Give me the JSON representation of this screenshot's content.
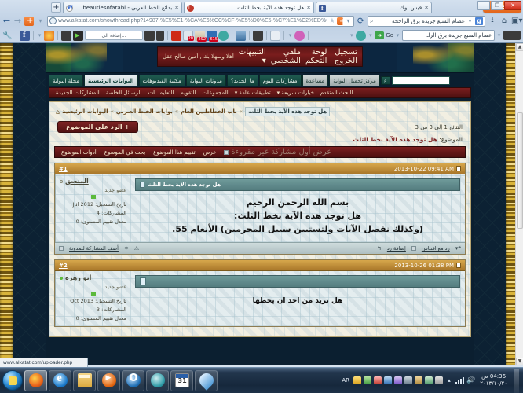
{
  "browser": {
    "app_button": "Firefox",
    "tabs": [
      {
        "label": "فيس بوك",
        "favicon": "facebook-icon",
        "active": false
      },
      {
        "label": "هل توجد هذه الآية بخط الثلث",
        "favicon": "forum-icon",
        "active": true
      },
      {
        "label": "بدائع الخط العربي - beautiesofarabi...",
        "favicon": "wordpress-icon",
        "active": false
      }
    ],
    "new_tab_label": "+",
    "window_controls": {
      "minimize": "–",
      "maximize": "❐",
      "close": "✕"
    },
    "url": "www.alkatat.com/showthread.php?14987-%E5%E1-%CA%E6%CC%CF-%E5%D0%E5-%C7%E1%C2%ED%C9-%C8%CE%D8-%C7%",
    "url_prefix": "www.alkatat.com",
    "url_host_bold": "alkatat.com",
    "search_engine": "Google",
    "search_value": "عصام السبع جريدة برق الراجحة",
    "bookmarks_go_value": "عصام السبع جريدة برق الراـ",
    "go_button": "Go",
    "bookmark_badges": [
      "20",
      "292",
      "615"
    ],
    "status_url": "www.alkatat.com/uploader.php"
  },
  "forum": {
    "welcome": {
      "greeting": "أهلا وسهلا بك , أمين صالح عقل",
      "links": [
        "التنبيهات ▾",
        "ملفي الشخصي",
        "لوحة التحكم",
        "تسجيل الخروج"
      ]
    },
    "nav_primary": [
      {
        "label": "مجلة البوابة",
        "state": "normal"
      },
      {
        "label": "البوابات الرئيسية",
        "state": "selected"
      },
      {
        "label": "مكتبة الفيديوهات",
        "state": "normal"
      },
      {
        "label": "مدونات البوابة",
        "state": "normal"
      },
      {
        "label": "ما الجديد؟",
        "state": "normal"
      },
      {
        "label": "مشاركات اليوم",
        "state": "normal"
      },
      {
        "label": "مساعدة",
        "state": "grey"
      },
      {
        "label": "مركز تحميل البوابة",
        "state": "grey"
      }
    ],
    "search": {
      "value": "",
      "button": "⌕"
    },
    "nav_secondary": [
      "المشاركات الجديدة",
      "الرسائل الخاصة",
      "التعليمـــات",
      "التقويم",
      "المجموعات",
      "تطبيقات عامة ▾",
      "خيارات سريعة ▾"
    ],
    "nav_secondary_advanced": "البحث المتقدم",
    "breadcrumb": {
      "home_icon": "home-icon",
      "items": [
        "البوابات الرئيسية",
        "بوابات الخـط العـربي",
        "باب الخطاطـين العام"
      ],
      "current": "هل توجد هذه الآية بخط الثلث",
      "separator": "»"
    },
    "reply_button": "+ الرد على الموضوع",
    "results_text": "النتائج 1 إلى 3 من 3",
    "subject_label": "الموضوع:",
    "subject_value": "هل توجد هذه الآية بخط الثلث",
    "thread_toolbar": [
      "أدوات الموضوع",
      "بحث في الموضوع",
      "تقييم هذا الموضوع",
      "عرض"
    ],
    "thread_toolbar_greyed": "عرض أول مشاركة غير مقروءة",
    "posts": [
      {
        "number": "#1",
        "date": "2013-10-22 09:41 AM",
        "user": {
          "name": "المنسق",
          "rank": "عضو جديد",
          "join_label": "تاريخ التسجيل:",
          "join_value": "Jul 2012",
          "posts_label": "المشاركات:",
          "posts_value": "4",
          "rep_label": "معدل تقييم المستوى:",
          "rep_value": "0",
          "online": false
        },
        "title": "هل توجد هذه الآية بخط الثلث",
        "lines": [
          "بسم الله الرحمن الرحيم",
          "هل توجد هذه الآية بخط الثلث:",
          "(وكذلك نفصل الآيات ولتستبين سبيل المجرمين) الأنعام 55."
        ],
        "footer": {
          "blog_link": "أضف المشاركة للمدونة",
          "reply_link": "إضافة رد",
          "quote_link": "رد مع اقتباس"
        }
      },
      {
        "number": "#2",
        "date": "2013-10-26 01:38 PM",
        "user": {
          "name": "أبو زهره",
          "rank": "عضو جديد",
          "join_label": "تاريخ التسجيل:",
          "join_value": "Oct 2013",
          "posts_label": "المشاركات:",
          "posts_value": "3",
          "rep_label": "معدل تقييم المستوى:",
          "rep_value": "0",
          "online": true
        },
        "title": "",
        "lines": [
          "هل تريد من احد ان يخطها"
        ],
        "footer": {
          "blog_link": "",
          "reply_link": "",
          "quote_link": ""
        }
      }
    ]
  },
  "taskbar": {
    "start": "start-orb",
    "buttons": [
      "firefox-taskbar-button",
      "internet-explorer-taskbar-button",
      "file-explorer-taskbar-button",
      "media-player-taskbar-button",
      "opera-taskbar-button",
      "messenger-taskbar-button",
      "calendar-taskbar-button",
      "paint-taskbar-button"
    ],
    "language": "AR",
    "clock_time": "04:36 ص",
    "clock_date": "٢٠١٣/١٠/٢٠"
  },
  "colors": {
    "accent_gold": "#c49a2c",
    "accent_maroon": "#7c1f1f",
    "accent_teal": "#1f5a4f",
    "page_bg": "#0c2133",
    "content_bg": "#f2efe2",
    "post_bg": "#e4edef"
  }
}
